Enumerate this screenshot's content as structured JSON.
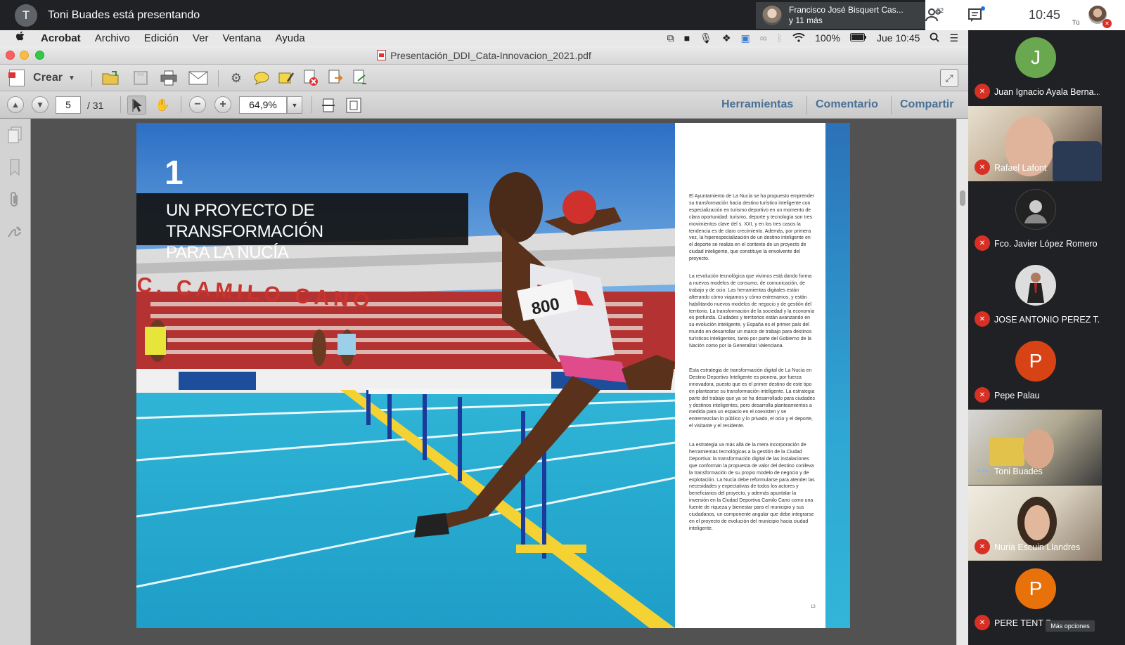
{
  "meet": {
    "presenter_initial": "T",
    "presenting_text": "Toni Buades está presentando",
    "others_line1": "Francisco José Bisquert Cas...",
    "others_line2": "y 11 más",
    "participants_count": "22",
    "clock": "10:45",
    "self_label": "Tú",
    "more_options": "Más opciones",
    "participants": [
      {
        "initial": "J",
        "name": "Juan Ignacio Ayala Berna...",
        "color": "#6aa84f"
      },
      {
        "initial": "",
        "name": "Rafael Lafont"
      },
      {
        "initial": "",
        "name": "Fco. Javier López Romero"
      },
      {
        "initial": "",
        "name": "JOSE ANTONIO PEREZ T..."
      },
      {
        "initial": "P",
        "name": "Pepe Palau",
        "color": "#d84315"
      },
      {
        "initial": "",
        "name": "Toni Buades"
      },
      {
        "initial": "",
        "name": "Nuria Escuin Llandres"
      },
      {
        "initial": "P",
        "name": "PERE TENT R",
        "color": "#e8710a"
      }
    ]
  },
  "menubar": {
    "apple": "",
    "app": "Acrobat",
    "items": [
      "Archivo",
      "Edición",
      "Ver",
      "Ventana",
      "Ayuda"
    ],
    "battery": "100%",
    "datetime": "Jue 10:45"
  },
  "window": {
    "title": "Presentación_DDI_Cata-Innovacion_2021.pdf"
  },
  "toolbar": {
    "crear": "Crear",
    "page_current": "5",
    "page_total": "/ 31",
    "zoom": "64,9%",
    "herramientas": "Herramientas",
    "comentario": "Comentario",
    "compartir": "Compartir"
  },
  "document": {
    "chapter_number": "1",
    "chapter_title_line1": "UN PROYECTO DE TRANSFORMACIÓN",
    "chapter_title_line2": "PARA LA NUCÍA",
    "stadium_sign": "C. CAMILO CANO",
    "bib_number": "800",
    "paragraph1": "El Ayuntamiento de La Nucía se ha propuesto emprender su transformación hacia destino turístico inteligente con especialización en turismo deportivo en un momento de clara oportunidad: turismo, deporte y tecnología son tres movimientos clave del s. XXI, y en los tres casos la tendencia es de claro crecimiento. Además, por primera vez, la hiperespecialización de un destino inteligente en el deporte se realiza en el contexto de un proyecto de ciudad inteligente, que constituye la envolvente del proyecto.",
    "paragraph2": "La revolución tecnológica que vivimos está dando forma a nuevos modelos de consumo, de comunicación, de trabajo y de ocio. Las herramientas digitales están alterando cómo viajamos y cómo entrenamos, y están habilitando nuevos modelos de negocio y de gestión del territorio. La transformación de la sociedad y la economía es profunda. Ciudades y territorios están avanzando en su evolución inteligente, y España es el primer país del mundo en desarrollar un marco de trabajo para destinos turísticos inteligentes, tanto por parte del Gobierno de la Nación como por la Generalitat Valenciana.",
    "paragraph3": "Esta estrategia de transformación digital de La Nucía en Destino Deportivo Inteligente es pionera, por fuerza innovadora, puesto que es el primer destino de este tipo en plantearse su transformación inteligente. La estrategia parte del trabajo que ya se ha desarrollado para ciudades y destinos inteligentes, pero desarrolla planteamientos a medida para un espacio en el coexisten y se entremezclan lo público y lo privado, el ocio y el deporte, el visitante y el residente.",
    "paragraph4": "La estrategia va más allá de la mera incorporación de herramientas tecnológicas a la gestión de la Ciudad Deportiva: la transformación digital de las instalaciones que conforman la propuesta de valor del destino conlleva la transformación de su propio modelo de negocio y de explotación. La Nucía debe reformularse para atender las necesidades y expectativas de todos los actores y beneficiarios del proyecto, y además apuntalar la inversión en la Ciudad Deportiva Camilo Cano como una fuente de riqueza y bienestar para el municipio y sus ciudadanos, un componente angular que debe integrarse en el proyecto de evolución del municipio hacia ciudad inteligente.",
    "page_number": "13"
  }
}
